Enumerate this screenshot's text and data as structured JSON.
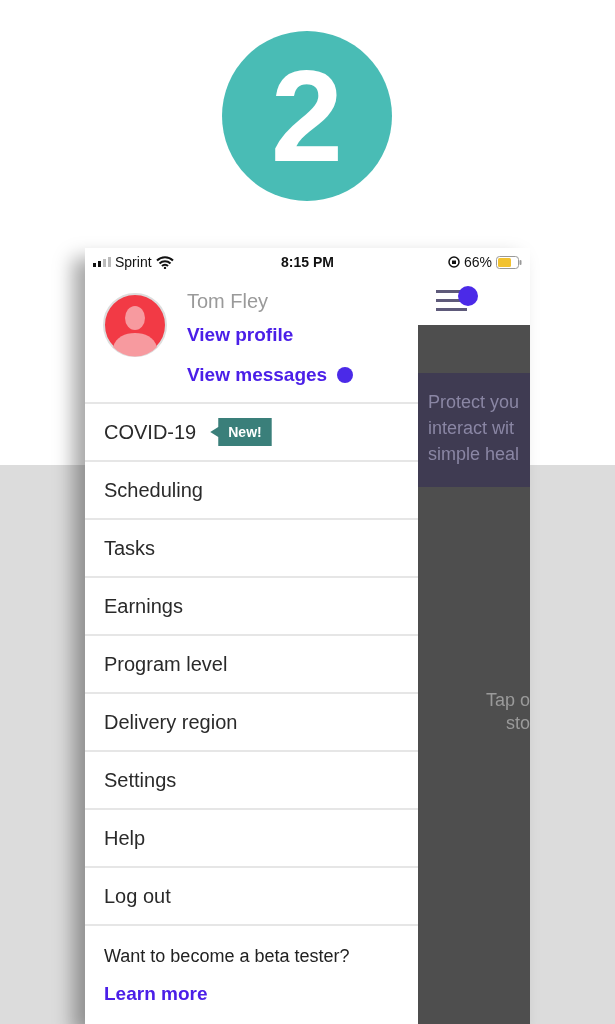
{
  "step": {
    "number": "2"
  },
  "status_bar": {
    "carrier": "Sprint",
    "time": "8:15 PM",
    "battery": "66%"
  },
  "profile": {
    "name": "Tom Fley",
    "view_profile": "View profile",
    "view_messages": "View messages",
    "unread_messages": true
  },
  "menu": [
    {
      "label": "COVID-19",
      "badge": "New!"
    },
    {
      "label": "Scheduling"
    },
    {
      "label": "Tasks"
    },
    {
      "label": "Earnings"
    },
    {
      "label": "Program level"
    },
    {
      "label": "Delivery region"
    },
    {
      "label": "Settings"
    },
    {
      "label": "Help"
    },
    {
      "label": "Log out"
    }
  ],
  "beta": {
    "question": "Want to become a beta tester?",
    "link": "Learn more"
  },
  "background_screen": {
    "menu_notification": true,
    "banner_lines": [
      "Protect you",
      "interact wit",
      "simple heal"
    ],
    "hint_lines": [
      "Tap o",
      "sto"
    ]
  }
}
